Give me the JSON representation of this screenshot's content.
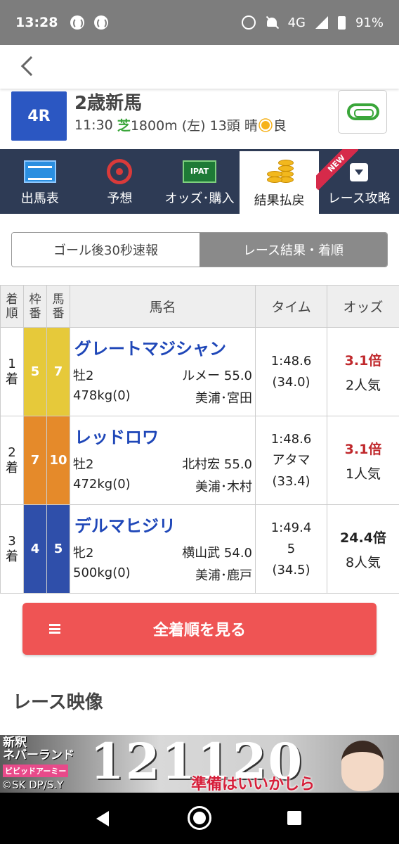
{
  "status_bar": {
    "time": "13:28",
    "network": "4G",
    "battery": "91%"
  },
  "race": {
    "number": "4R",
    "name": "2歳新馬",
    "start_time": "11:30",
    "surface": "芝",
    "distance": "1800m (左)",
    "runners": "13頭",
    "weather": "晴",
    "going": "良"
  },
  "tabs": [
    {
      "label": "出馬表",
      "icon": "entry-list-icon"
    },
    {
      "label": "予想",
      "icon": "target-icon"
    },
    {
      "label": "オッズ･購入",
      "icon": "ipat-icon",
      "icon_text": "IPAT"
    },
    {
      "label": "結果払戻",
      "icon": "coins-icon",
      "active": true
    },
    {
      "label": "レース攻略",
      "icon": "play-down-icon",
      "badge": "NEW"
    }
  ],
  "segment": {
    "left": "ゴール後30秒速報",
    "right": "レース結果・着順"
  },
  "table": {
    "headers": {
      "rank": [
        "着",
        "順"
      ],
      "frame": [
        "枠",
        "番"
      ],
      "horse_no": [
        "馬",
        "番"
      ],
      "name": "馬名",
      "time": "タイム",
      "odds": "オッズ"
    },
    "rows": [
      {
        "rank": [
          "1",
          "着"
        ],
        "frame": "5",
        "horse_no": "7",
        "frame_color": "#e6c93a",
        "name": "グレートマジシャン",
        "sex_age": "牡2",
        "jockey_weight": "ルメー 55.0",
        "body_weight": "478kg(0)",
        "stable": "美浦･宮田",
        "time": "1:48.6",
        "margin": "",
        "last3f": "(34.0)",
        "odds": "3.1倍",
        "popularity": "2人気"
      },
      {
        "rank": [
          "2",
          "着"
        ],
        "frame": "7",
        "horse_no": "10",
        "frame_color": "#e58a2a",
        "name": "レッドロワ",
        "sex_age": "牡2",
        "jockey_weight": "北村宏 55.0",
        "body_weight": "472kg(0)",
        "stable": "美浦･木村",
        "time": "1:48.6",
        "margin": "アタマ",
        "last3f": "(33.4)",
        "odds": "3.1倍",
        "popularity": "1人気"
      },
      {
        "rank": [
          "3",
          "着"
        ],
        "frame": "4",
        "horse_no": "5",
        "frame_color": "#2f4faa",
        "name": "デルマヒジリ",
        "sex_age": "牝2",
        "jockey_weight": "横山武 54.0",
        "body_weight": "500kg(0)",
        "stable": "美浦･鹿戸",
        "time": "1:49.4",
        "margin": "5",
        "last3f": "(34.5)",
        "odds": "24.4倍",
        "popularity": "8人気"
      }
    ]
  },
  "all_results_button": "全着順を見る",
  "section_title": "レース映像",
  "ad": {
    "title_line1": "新釈",
    "title_line2": "ネバーランド",
    "subtitle": "ビビッドアーミー",
    "copyright": "©SK DP/S.Y",
    "number": "121120",
    "tagline": "準備はいいかしら"
  },
  "colors": {
    "accent_blue": "#2b57c2",
    "tabbar": "#2e3b55",
    "button_red": "#ef5454",
    "odds_red": "#c0282c",
    "turf_green": "#3aa63a"
  }
}
